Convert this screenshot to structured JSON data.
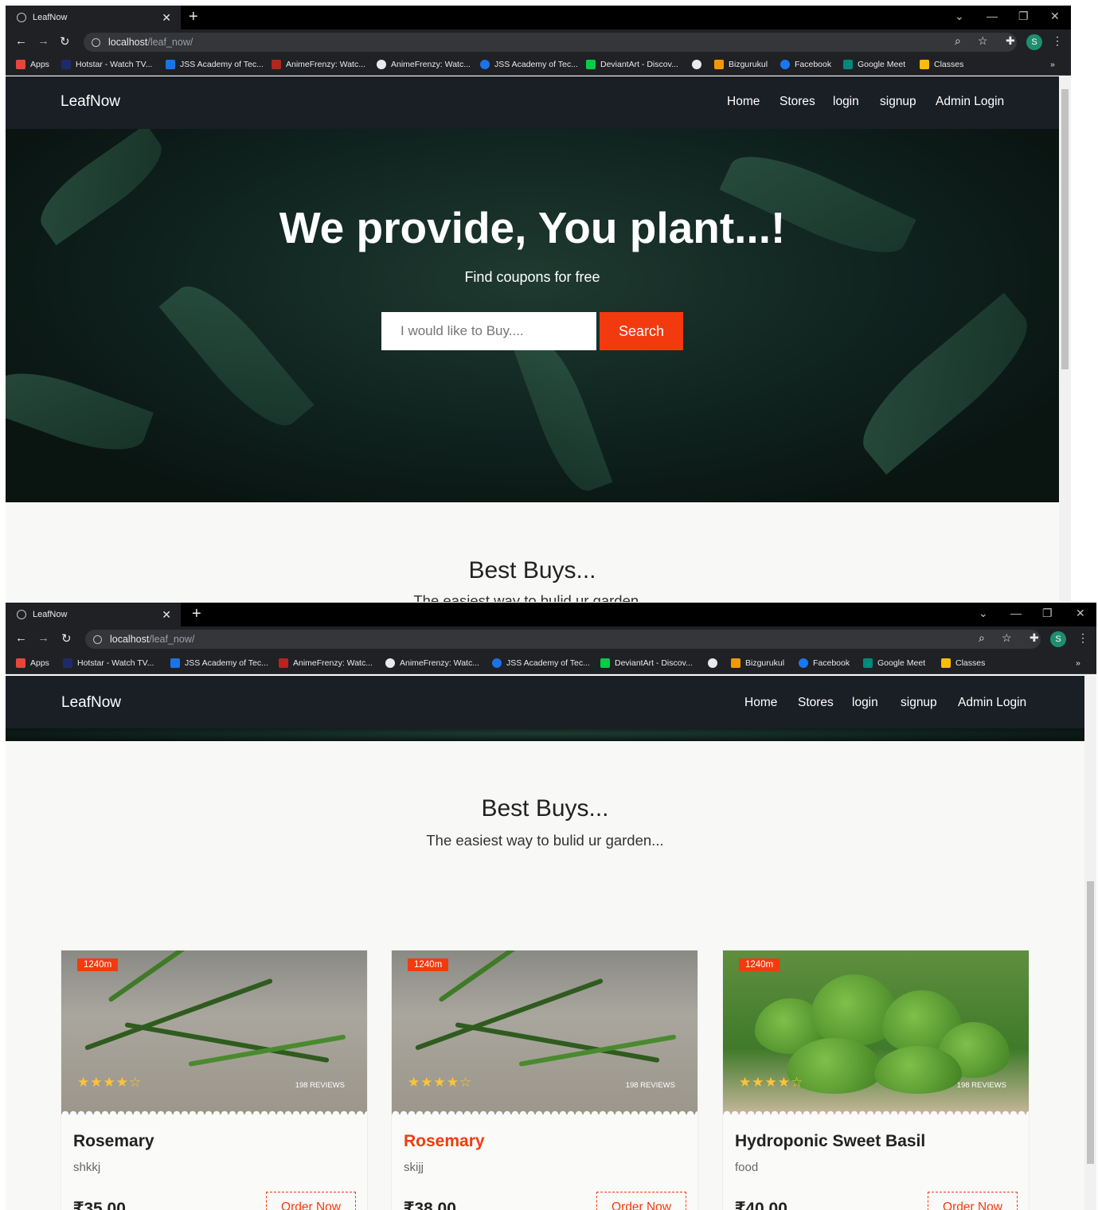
{
  "browser": {
    "tab_title": "LeafNow",
    "url_host": "localhost",
    "url_path": "/leaf_now/",
    "new_tab": "+",
    "avatar_letter": "S",
    "bookmarks": [
      "Apps",
      "Hotstar - Watch TV...",
      "JSS Academy of Tec...",
      "AnimeFrenzy: Watc...",
      "AnimeFrenzy: Watc...",
      "JSS Academy of Tec...",
      "DeviantArt - Discov...",
      "",
      "Bizgurukul",
      "Facebook",
      "Google Meet",
      "Classes"
    ],
    "more": "»"
  },
  "site": {
    "brand": "LeafNow",
    "nav": [
      "Home",
      "Stores",
      "login",
      "signup",
      "Admin Login"
    ],
    "hero_title": "We provide, You plant...!",
    "hero_sub": "Find coupons for free",
    "search_placeholder": "I would like to Buy....",
    "search_button": "Search",
    "section_title": "Best Buys...",
    "section_sub": "The easiest way to bulid ur garden...",
    "products": [
      {
        "badge": "1240m",
        "rating": 4,
        "reviews": "198 REVIEWS",
        "name": "Rosemary",
        "desc": "shkkj",
        "price": "₹35.00",
        "order": "Order Now",
        "image": "rosemary"
      },
      {
        "badge": "1240m",
        "rating": 4,
        "reviews": "198 REVIEWS",
        "name": "Rosemary",
        "desc": "skijj",
        "price": "₹38.00",
        "order": "Order Now",
        "image": "rosemary",
        "highlighted": true
      },
      {
        "badge": "1240m",
        "rating": 4,
        "reviews": "198 REVIEWS",
        "name": "Hydroponic Sweet Basil",
        "desc": "food",
        "price": "₹40.00",
        "order": "Order Now",
        "image": "basil"
      }
    ]
  },
  "colors": {
    "accent": "#f33a0f",
    "navbar": "#1a1e25",
    "star": "#f9c53a"
  }
}
